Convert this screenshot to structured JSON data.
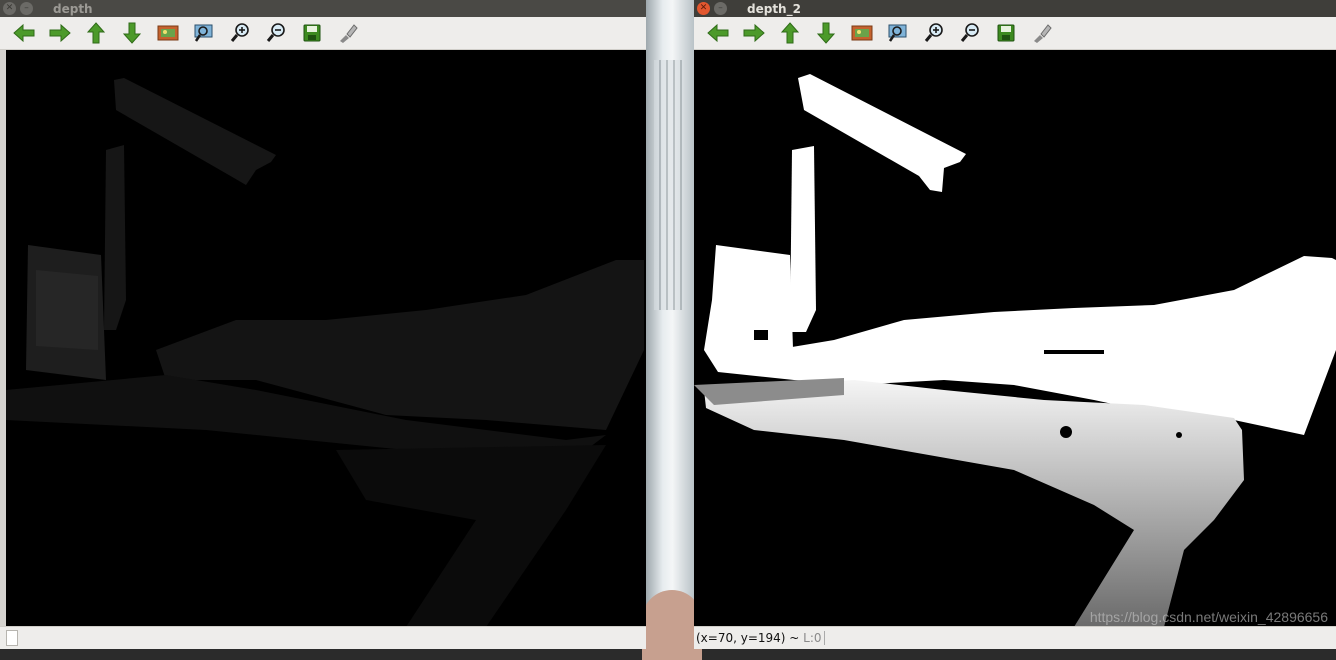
{
  "windows": [
    {
      "id": "depth",
      "title": "depth",
      "active": false,
      "status": ""
    },
    {
      "id": "depth_2",
      "title": "depth_2",
      "active": true,
      "status_coords": "(x=70, y=194) ~ ",
      "status_level": "L:0"
    }
  ],
  "toolbar": {
    "tools": [
      {
        "icon": "arrow-left-icon"
      },
      {
        "icon": "arrow-right-icon"
      },
      {
        "icon": "arrow-up-icon"
      },
      {
        "icon": "arrow-down-icon"
      },
      {
        "icon": "picture-icon"
      },
      {
        "icon": "zoom-fit-icon"
      },
      {
        "icon": "zoom-in-icon"
      },
      {
        "icon": "zoom-out-icon"
      },
      {
        "icon": "save-icon"
      },
      {
        "icon": "properties-icon"
      }
    ]
  },
  "watermark": "https://blog.csdn.net/weixin_42896656",
  "colors": {
    "toolbar_green": "#4c9a2a",
    "close_button": "#e2572f",
    "titlebar": "#3f3e3a"
  }
}
